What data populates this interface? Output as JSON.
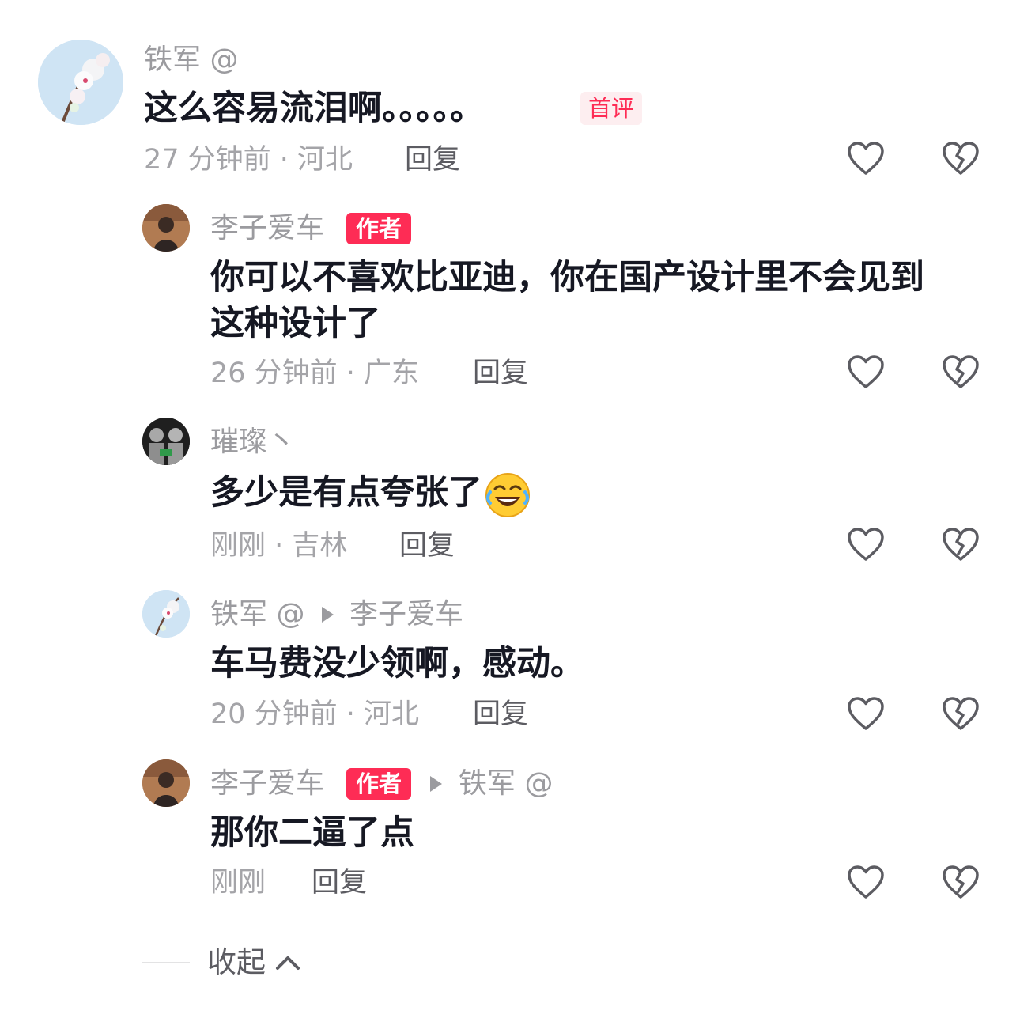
{
  "comments": [
    {
      "username": "铁军 @",
      "badge": "首评",
      "content": "这么容易流泪啊。。。。。",
      "time_location": "27 分钟前 · 河北",
      "reply": "回复"
    },
    {
      "username": "李子爱车",
      "badge": "作者",
      "content_line1": "你可以不喜欢比亚迪，你在国产设计里不会见到",
      "content_line2": "这种设计了",
      "time_location": "26 分钟前 · 广东",
      "reply": "回复"
    },
    {
      "username": "璀璨丶",
      "content": "多少是有点夸张了",
      "emoji": "rolling-on-floor-laughing-emoji",
      "time_location": "刚刚 · 吉林",
      "reply": "回复"
    },
    {
      "username": "铁军 @",
      "reply_to": "李子爱车",
      "content": "车马费没少领啊，感动。",
      "time_location": "20 分钟前 · 河北",
      "reply": "回复"
    },
    {
      "username": "李子爱车",
      "badge": "作者",
      "reply_to": "铁军 @",
      "content": "那你二逼了点",
      "time_location": "刚刚",
      "reply": "回复"
    }
  ],
  "collapse": {
    "label": "收起"
  },
  "colors": {
    "accent": "#fe2c55",
    "text": "#161823",
    "muted": "#9b9b9f"
  },
  "icons": [
    "heart-outline-icon",
    "broken-heart-icon",
    "chevron-up-icon",
    "play-arrow-icon"
  ]
}
